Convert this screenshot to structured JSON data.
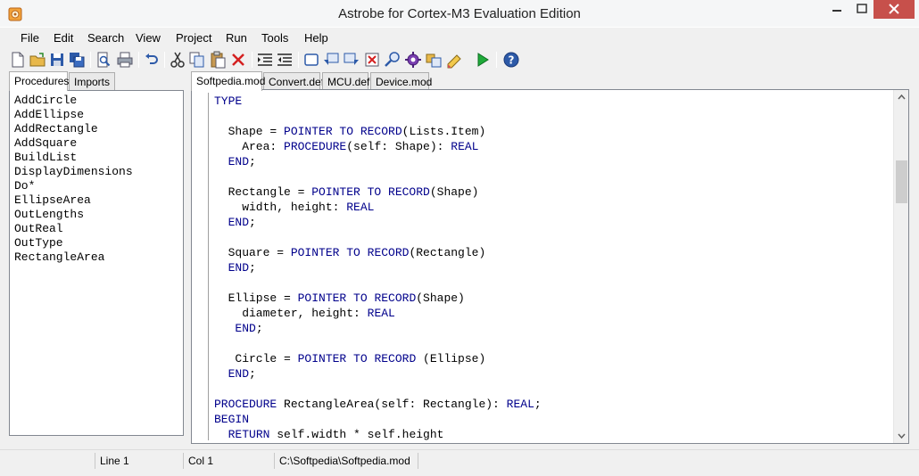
{
  "window": {
    "title": "Astrobe for Cortex-M3 Evaluation Edition",
    "icon": "astrobe-app-icon"
  },
  "menu": [
    "File",
    "Edit",
    "Search",
    "View",
    "Project",
    "Run",
    "Tools",
    "Help"
  ],
  "toolbar": {
    "icons": [
      "new-file-icon",
      "open-folder-icon",
      "save-icon",
      "save-all-icon",
      "print-preview-icon",
      "print-icon",
      "undo-icon",
      "cut-icon",
      "copy-icon",
      "paste-icon",
      "delete-icon",
      "indent-icon",
      "outdent-icon",
      "window-icon",
      "comment-icon",
      "uncomment-icon",
      "clear-icon",
      "find-icon",
      "settings-gear-icon",
      "build-icon",
      "compile-icon",
      "run-icon",
      "help-icon"
    ]
  },
  "left_panel": {
    "tabs": [
      "Procedures",
      "Imports"
    ],
    "active_tab": "Procedures",
    "procedures": [
      "AddCircle",
      "AddEllipse",
      "AddRectangle",
      "AddSquare",
      "BuildList",
      "DisplayDimensions",
      "Do*",
      "EllipseArea",
      "OutLengths",
      "OutReal",
      "OutType",
      "RectangleArea"
    ]
  },
  "editor": {
    "tabs": [
      "Softpedia.mod",
      "Convert.def",
      "MCU.def",
      "Device.mod"
    ],
    "active_tab": "Softpedia.mod",
    "lines": [
      [
        {
          "t": "TYPE",
          "k": true
        }
      ],
      [],
      [
        {
          "t": "  Shape = "
        },
        {
          "t": "POINTER TO RECORD",
          "k": true
        },
        {
          "t": "(Lists.Item)"
        }
      ],
      [
        {
          "t": "    Area: "
        },
        {
          "t": "PROCEDURE",
          "k": true
        },
        {
          "t": "(self: Shape): "
        },
        {
          "t": "REAL",
          "k": true
        }
      ],
      [
        {
          "t": "  "
        },
        {
          "t": "END",
          "k": true
        },
        {
          "t": ";"
        }
      ],
      [],
      [
        {
          "t": "  Rectangle = "
        },
        {
          "t": "POINTER TO RECORD",
          "k": true
        },
        {
          "t": "(Shape)"
        }
      ],
      [
        {
          "t": "    width, height: "
        },
        {
          "t": "REAL",
          "k": true
        }
      ],
      [
        {
          "t": "  "
        },
        {
          "t": "END",
          "k": true
        },
        {
          "t": ";"
        }
      ],
      [],
      [
        {
          "t": "  Square = "
        },
        {
          "t": "POINTER TO RECORD",
          "k": true
        },
        {
          "t": "(Rectangle)"
        }
      ],
      [
        {
          "t": "  "
        },
        {
          "t": "END",
          "k": true
        },
        {
          "t": ";"
        }
      ],
      [],
      [
        {
          "t": "  Ellipse = "
        },
        {
          "t": "POINTER TO RECORD",
          "k": true
        },
        {
          "t": "(Shape)"
        }
      ],
      [
        {
          "t": "    diameter, height: "
        },
        {
          "t": "REAL",
          "k": true
        }
      ],
      [
        {
          "t": "   "
        },
        {
          "t": "END",
          "k": true
        },
        {
          "t": ";"
        }
      ],
      [],
      [
        {
          "t": "   Circle = "
        },
        {
          "t": "POINTER TO RECORD",
          "k": true
        },
        {
          "t": " (Ellipse)"
        }
      ],
      [
        {
          "t": "  "
        },
        {
          "t": "END",
          "k": true
        },
        {
          "t": ";"
        }
      ],
      [],
      [
        {
          "t": "PROCEDURE",
          "k": true
        },
        {
          "t": " RectangleArea(self: Rectangle): "
        },
        {
          "t": "REAL",
          "k": true
        },
        {
          "t": ";"
        }
      ],
      [
        {
          "t": "BEGIN",
          "k": true
        }
      ],
      [
        {
          "t": "  "
        },
        {
          "t": "RETURN",
          "k": true
        },
        {
          "t": " self.width * self.height"
        }
      ]
    ]
  },
  "status": {
    "line": "Line 1",
    "col": "Col 1",
    "path": "C:\\Softpedia\\Softpedia.mod"
  },
  "colors": {
    "keyword": "#00008b",
    "close_button": "#c7504b"
  }
}
